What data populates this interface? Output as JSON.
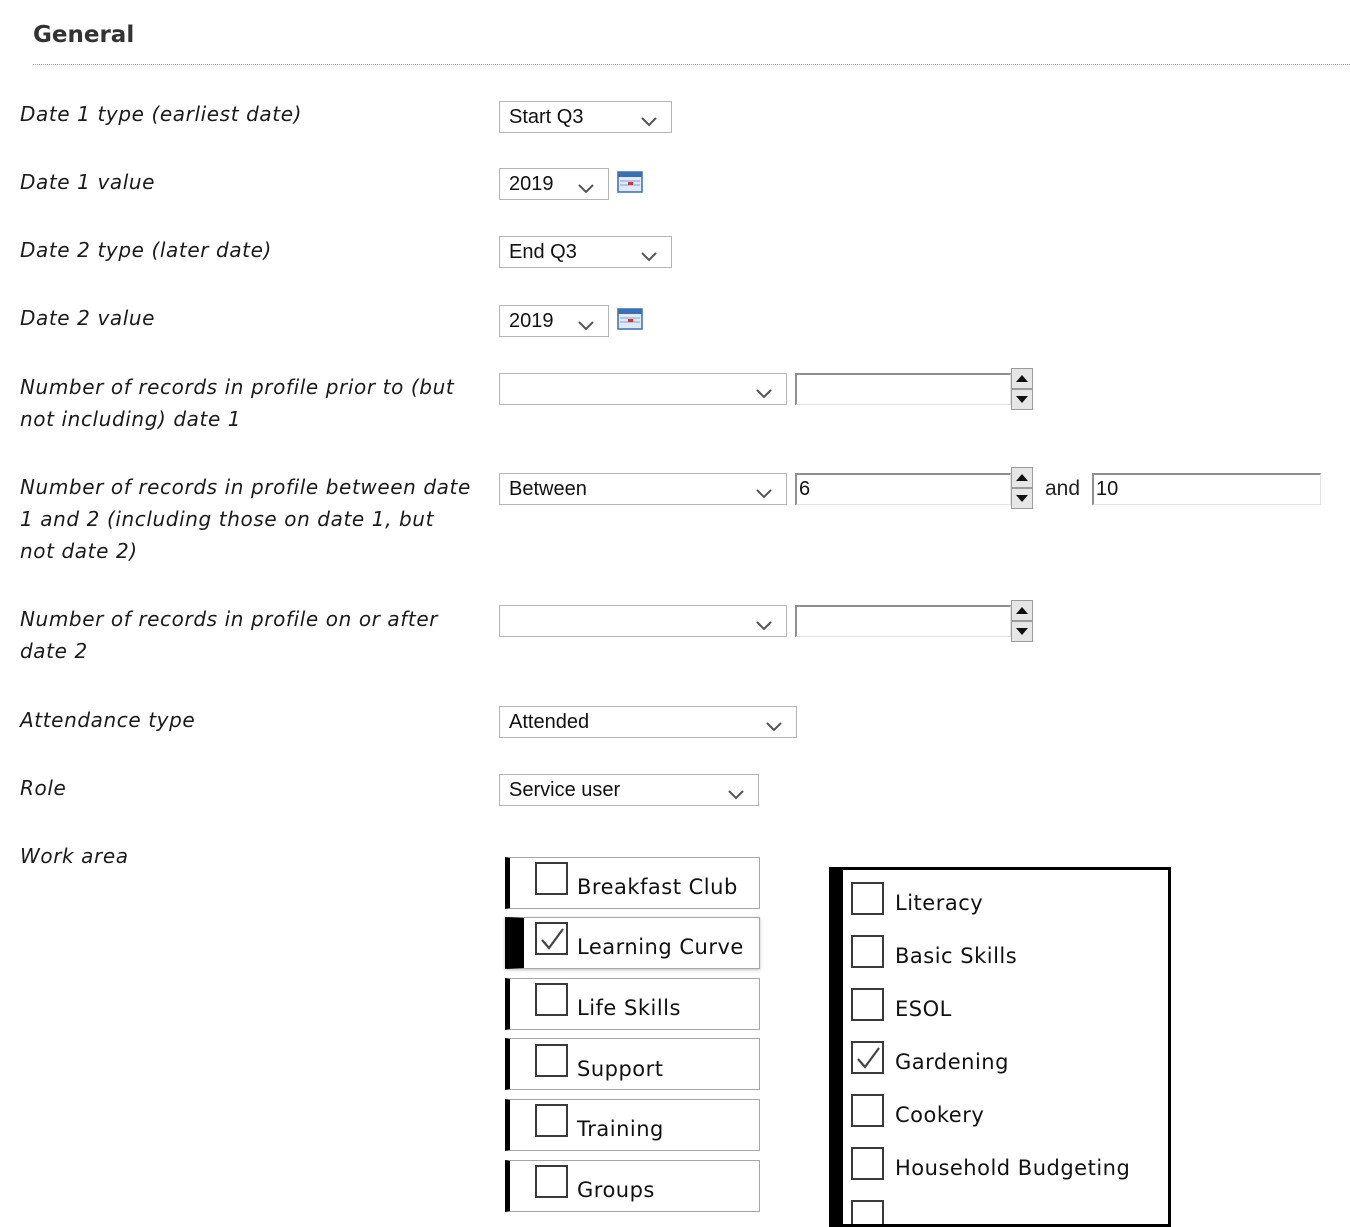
{
  "section": {
    "title": "General"
  },
  "form": {
    "date1_type": {
      "label": "Date 1 type (earliest date)",
      "value": "Start Q3"
    },
    "date1_value": {
      "label": "Date 1 value",
      "value": "2019"
    },
    "date2_type": {
      "label": "Date 2 type (later date)",
      "value": "End Q3"
    },
    "date2_value": {
      "label": "Date 2 value",
      "value": "2019"
    },
    "records_prior": {
      "label": "Number of records in profile prior to (but not including) date 1",
      "operator": "",
      "value": ""
    },
    "records_between": {
      "label": "Number of records in profile between date 1 and 2 (including those on date 1, but not date 2)",
      "operator": "Between",
      "value": "6",
      "and_label": "and",
      "value2": "10"
    },
    "records_after": {
      "label": "Number of records in profile on or after date 2",
      "operator": "",
      "value": ""
    },
    "attendance_type": {
      "label": "Attendance type",
      "value": "Attended"
    },
    "role": {
      "label": "Role",
      "value": "Service user"
    },
    "work_area": {
      "label": "Work area",
      "items": [
        {
          "label": "Breakfast Club",
          "checked": false,
          "active": false
        },
        {
          "label": "Learning Curve",
          "checked": true,
          "active": true
        },
        {
          "label": "Life Skills",
          "checked": false,
          "active": false
        },
        {
          "label": "Support",
          "checked": false,
          "active": false
        },
        {
          "label": "Training",
          "checked": false,
          "active": false
        },
        {
          "label": "Groups",
          "checked": false,
          "active": false
        }
      ],
      "sub_items": [
        {
          "label": "Literacy",
          "checked": false
        },
        {
          "label": "Basic Skills",
          "checked": false
        },
        {
          "label": "ESOL",
          "checked": false
        },
        {
          "label": "Gardening",
          "checked": true
        },
        {
          "label": "Cookery",
          "checked": false
        },
        {
          "label": "Household Budgeting",
          "checked": false
        }
      ]
    }
  },
  "icons": {
    "dropdown": "chevron-down-icon",
    "calendar": "calendar-icon",
    "spinner": "spin-up-down-icon",
    "check": "check-icon"
  }
}
